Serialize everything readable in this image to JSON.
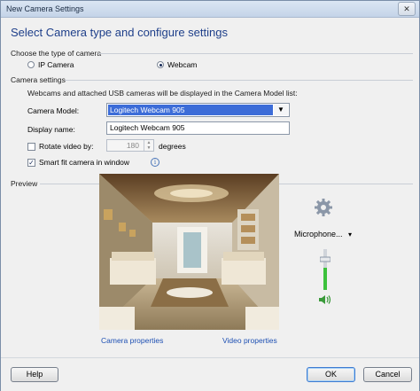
{
  "window": {
    "title": "New Camera Settings",
    "close_glyph": "✕"
  },
  "heading": "Select Camera type and configure settings",
  "camera_type": {
    "label": "Choose the type of camera",
    "options": [
      {
        "label": "IP Camera",
        "checked": false
      },
      {
        "label": "Webcam",
        "checked": true
      }
    ]
  },
  "camera_settings": {
    "label": "Camera settings",
    "info": "Webcams and attached USB cameras will be displayed in the Camera Model list:",
    "model_label": "Camera Model:",
    "model_value": "Logitech Webcam 905",
    "display_name_label": "Display name:",
    "display_name_value": "Logitech Webcam 905",
    "rotate_label": "Rotate video by:",
    "rotate_checked": false,
    "rotate_value": "180",
    "rotate_unit": "degrees",
    "smart_fit_label": "Smart fit camera in window",
    "smart_fit_checked": true,
    "info_icon": "info-icon"
  },
  "preview": {
    "label": "Preview",
    "camera_properties": "Camera properties",
    "video_properties": "Video properties",
    "microphone_label": "Microphone...",
    "microphone_arrow": "▾",
    "volume_level": 0.55
  },
  "buttons": {
    "help": "Help",
    "ok": "OK",
    "cancel": "Cancel"
  },
  "colors": {
    "accent": "#1e3f8a",
    "link": "#1e50b3",
    "selection": "#3c6cd8",
    "volume": "#3cc13c"
  }
}
